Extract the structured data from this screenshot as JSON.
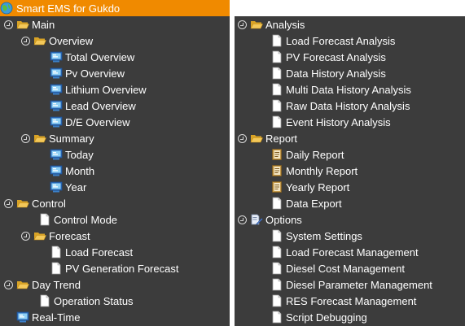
{
  "app": {
    "title": "Smart EMS for Gukdo",
    "colors": {
      "header": "#f08a00",
      "panel": "#3c3c3c",
      "text": "#ffffff"
    }
  },
  "left_tree": {
    "main": {
      "label": "Main",
      "overview": {
        "label": "Overview",
        "items": [
          "Total Overview",
          "Pv Overview",
          "Lithium Overview",
          "Lead Overview",
          "D/E Overview"
        ]
      },
      "summary": {
        "label": "Summary",
        "items": [
          "Today",
          "Month",
          "Year"
        ]
      }
    },
    "control": {
      "label": "Control",
      "control_mode": "Control Mode",
      "forecast": {
        "label": "Forecast",
        "items": [
          "Load Forecast",
          "PV Generation Forecast"
        ]
      }
    },
    "day_trend": {
      "label": "Day Trend",
      "operation_status": "Operation Status"
    },
    "real_time": "Real-Time"
  },
  "right_tree": {
    "analysis": {
      "label": "Analysis",
      "items": [
        "Load Forecast Analysis",
        "PV Forecast Analysis",
        "Data History Analysis",
        "Multi Data History Analysis",
        "Raw Data History Analysis",
        "Event History Analysis"
      ]
    },
    "report": {
      "label": "Report",
      "items": [
        "Daily Report",
        "Monthly Report",
        "Yearly Report",
        "Data Export"
      ]
    },
    "options": {
      "label": "Options",
      "items": [
        "System Settings",
        "Load Forecast Management",
        "Diesel Cost Management",
        "Diesel Parameter Management",
        "RES Forecast Management",
        "Script Debugging"
      ]
    }
  },
  "icons": {
    "app": "app-globe-icon",
    "folder": "folder-open-icon",
    "screen": "monitor-icon",
    "page": "document-icon",
    "report": "report-book-icon",
    "options": "options-edit-icon",
    "toggle": "collapse-toggle-icon"
  }
}
